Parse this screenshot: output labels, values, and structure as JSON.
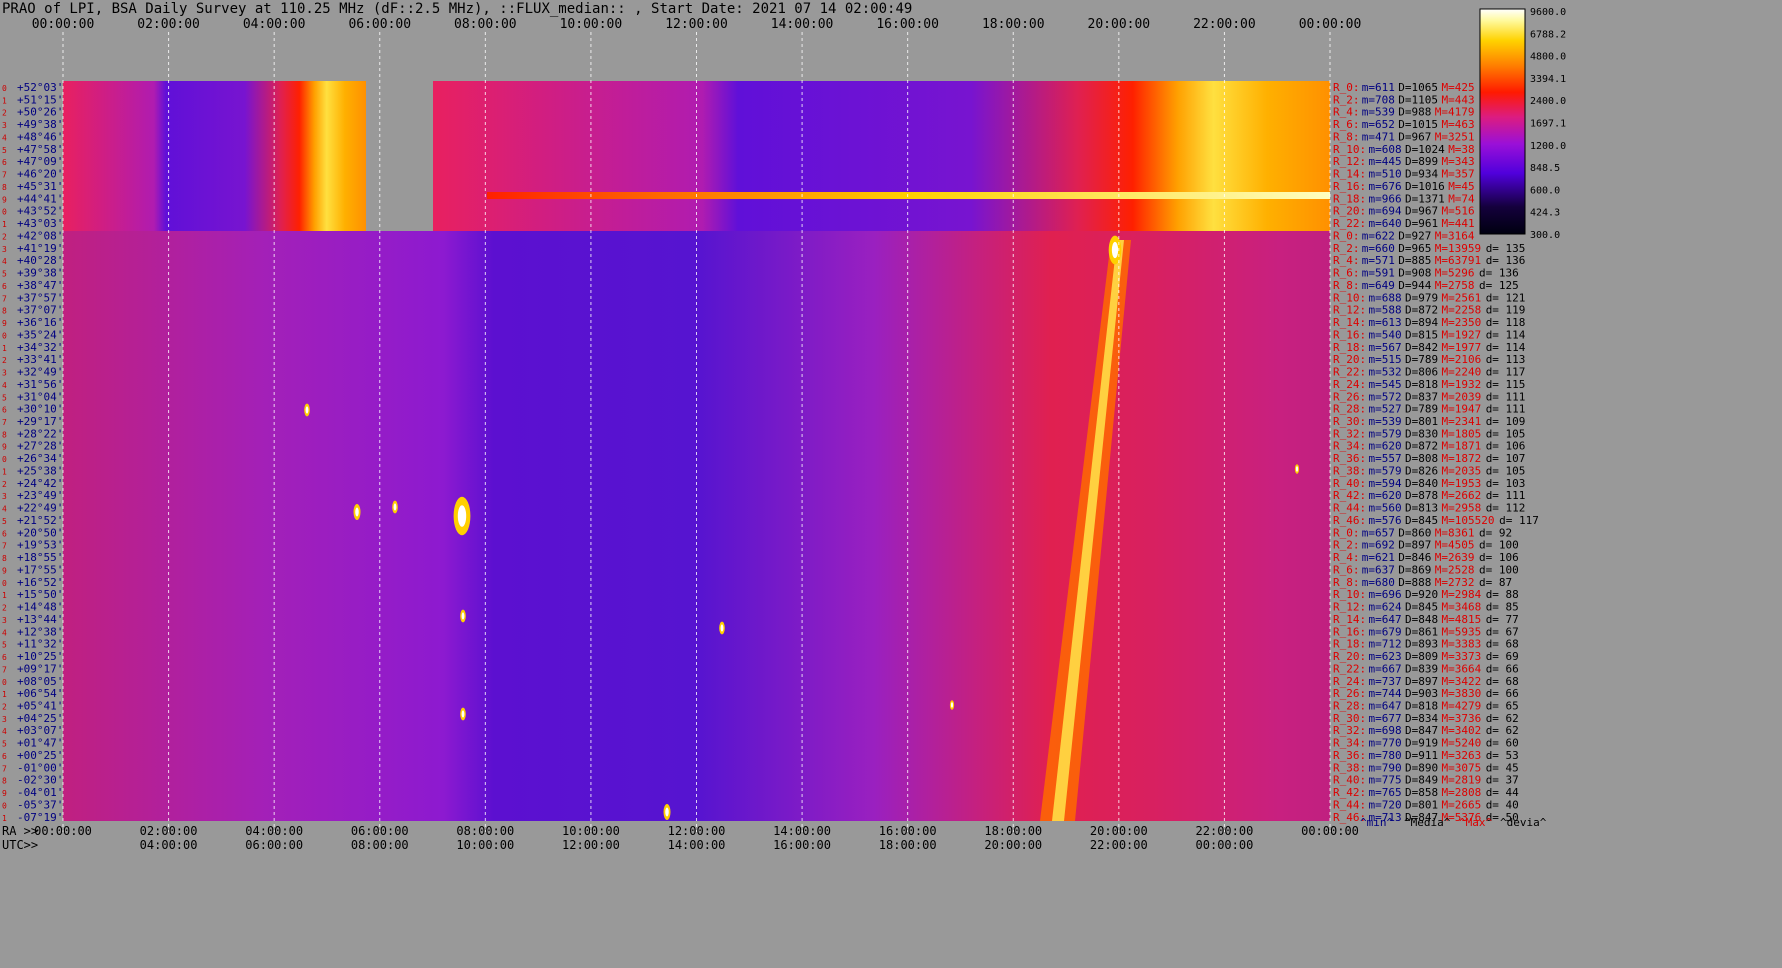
{
  "title": "PRAO of LPI, BSA Daily Survey at 110.25 MHz (dF::2.5 MHz), ::FLUX_median:: , Start Date: 2021 07 14 02:00:49",
  "colors": {
    "background": "#999999",
    "dec_labels_dark": "#000080",
    "dec_labels_red": "#cc0000",
    "stats_min": "#000080",
    "stats_max": "#dd0000"
  },
  "chart_data": {
    "type": "heatmap",
    "title": "PRAO of LPI, BSA Daily Survey at 110.25 MHz (dF::2.5 MHz), ::FLUX_median:: , Start Date: 2021 07 14 02:00:49",
    "x_top_ticks": [
      "00:00:00",
      "02:00:00",
      "04:00:00",
      "06:00:00",
      "08:00:00",
      "10:00:00",
      "12:00:00",
      "14:00:00",
      "16:00:00",
      "18:00:00",
      "20:00:00",
      "22:00:00",
      "00:00:00"
    ],
    "x_bottom_ra_label": "RA >>",
    "x_bottom_ra_ticks": [
      "00:00:00",
      "02:00:00",
      "04:00:00",
      "06:00:00",
      "08:00:00",
      "10:00:00",
      "12:00:00",
      "14:00:00",
      "16:00:00",
      "18:00:00",
      "20:00:00",
      "22:00:00",
      "00:00:00"
    ],
    "x_bottom_utc_label": "UTC>>",
    "x_bottom_utc_ticks": [
      "04:00:00",
      "06:00:00",
      "08:00:00",
      "10:00:00",
      "12:00:00",
      "14:00:00",
      "16:00:00",
      "18:00:00",
      "20:00:00",
      "22:00:00",
      "00:00:00"
    ],
    "dec_labels": [
      "+52°03'",
      "+51°15'",
      "+50°26'",
      "+49°38'",
      "+48°46'",
      "+47°58'",
      "+47°09'",
      "+46°20'",
      "+45°31'",
      "+44°41'",
      "+43°52'",
      "+43°03'",
      "+42°08'",
      "+41°19'",
      "+40°28'",
      "+39°38'",
      "+38°47'",
      "+37°57'",
      "+37°07'",
      "+36°16'",
      "+35°24'",
      "+34°32'",
      "+33°41'",
      "+32°49'",
      "+31°56'",
      "+31°04'",
      "+30°10'",
      "+29°17'",
      "+28°22'",
      "+27°28'",
      "+26°34'",
      "+25°38'",
      "+24°42'",
      "+23°49'",
      "+22°49'",
      "+21°52'",
      "+20°50'",
      "+19°53'",
      "+18°55'",
      "+17°55'",
      "+16°52'",
      "+15°50'",
      "+14°48'",
      "+13°44'",
      "+12°38'",
      "+11°32'",
      "+10°25'",
      "+09°17'",
      "+08°05'",
      "+06°54'",
      "+05°41'",
      "+04°25'",
      "+03°07'",
      "+01°47'",
      "+00°25'",
      "-01°00'",
      "-02°30'",
      "-04°01'",
      "-05°37'",
      "-07°19'"
    ],
    "colorbar": {
      "ticks": [
        "9600.0",
        "6788.2",
        "4800.0",
        "3394.1",
        "2400.0",
        "1697.1",
        "1200.0",
        "848.5",
        "600.0",
        "424.3",
        "300.0"
      ],
      "scale": "log"
    },
    "stats": [
      {
        "r": "R_0:",
        "m": "m=611",
        "d": "D=1065",
        "mx": "M=425",
        "dv": ""
      },
      {
        "r": "R_2:",
        "m": "m=708",
        "d": "D=1105",
        "mx": "M=443",
        "dv": ""
      },
      {
        "r": "R_4:",
        "m": "m=539",
        "d": "D=988",
        "mx": "M=4179",
        "dv": ""
      },
      {
        "r": "R_6:",
        "m": "m=652",
        "d": "D=1015",
        "mx": "M=463",
        "dv": ""
      },
      {
        "r": "R_8:",
        "m": "m=471",
        "d": "D=967",
        "mx": "M=3251",
        "dv": ""
      },
      {
        "r": "R_10:",
        "m": "m=608",
        "d": "D=1024",
        "mx": "M=38",
        "dv": ""
      },
      {
        "r": "R_12:",
        "m": "m=445",
        "d": "D=899",
        "mx": "M=343",
        "dv": ""
      },
      {
        "r": "R_14:",
        "m": "m=510",
        "d": "D=934",
        "mx": "M=357",
        "dv": ""
      },
      {
        "r": "R_16:",
        "m": "m=676",
        "d": "D=1016",
        "mx": "M=45",
        "dv": ""
      },
      {
        "r": "R_18:",
        "m": "m=966",
        "d": "D=1371",
        "mx": "M=74",
        "dv": ""
      },
      {
        "r": "R_20:",
        "m": "m=694",
        "d": "D=967",
        "mx": "M=516",
        "dv": ""
      },
      {
        "r": "R_22:",
        "m": "m=640",
        "d": "D=961",
        "mx": "M=441",
        "dv": ""
      },
      {
        "r": "R_0:",
        "m": "m=622",
        "d": "D=927",
        "mx": "M=3164",
        "dv": ""
      },
      {
        "r": "R_2:",
        "m": "m=660",
        "d": "D=965",
        "mx": "M=13959",
        "dv": "d= 135"
      },
      {
        "r": "R_4:",
        "m": "m=571",
        "d": "D=885",
        "mx": "M=63791",
        "dv": "d= 136"
      },
      {
        "r": "R_6:",
        "m": "m=591",
        "d": "D=908",
        "mx": "M=5296",
        "dv": "d= 136"
      },
      {
        "r": "R_8:",
        "m": "m=649",
        "d": "D=944",
        "mx": "M=2758",
        "dv": "d= 125"
      },
      {
        "r": "R_10:",
        "m": "m=688",
        "d": "D=979",
        "mx": "M=2561",
        "dv": "d= 121"
      },
      {
        "r": "R_12:",
        "m": "m=588",
        "d": "D=872",
        "mx": "M=2258",
        "dv": "d= 119"
      },
      {
        "r": "R_14:",
        "m": "m=613",
        "d": "D=894",
        "mx": "M=2350",
        "dv": "d= 118"
      },
      {
        "r": "R_16:",
        "m": "m=540",
        "d": "D=815",
        "mx": "M=1927",
        "dv": "d= 114"
      },
      {
        "r": "R_18:",
        "m": "m=567",
        "d": "D=842",
        "mx": "M=1977",
        "dv": "d= 114"
      },
      {
        "r": "R_20:",
        "m": "m=515",
        "d": "D=789",
        "mx": "M=2106",
        "dv": "d= 113"
      },
      {
        "r": "R_22:",
        "m": "m=532",
        "d": "D=806",
        "mx": "M=2240",
        "dv": "d= 117"
      },
      {
        "r": "R_24:",
        "m": "m=545",
        "d": "D=818",
        "mx": "M=1932",
        "dv": "d= 115"
      },
      {
        "r": "R_26:",
        "m": "m=572",
        "d": "D=837",
        "mx": "M=2039",
        "dv": "d= 111"
      },
      {
        "r": "R_28:",
        "m": "m=527",
        "d": "D=789",
        "mx": "M=1947",
        "dv": "d= 111"
      },
      {
        "r": "R_30:",
        "m": "m=539",
        "d": "D=801",
        "mx": "M=2341",
        "dv": "d= 109"
      },
      {
        "r": "R_32:",
        "m": "m=579",
        "d": "D=830",
        "mx": "M=1805",
        "dv": "d= 105"
      },
      {
        "r": "R_34:",
        "m": "m=620",
        "d": "D=872",
        "mx": "M=1871",
        "dv": "d= 106"
      },
      {
        "r": "R_36:",
        "m": "m=557",
        "d": "D=808",
        "mx": "M=1872",
        "dv": "d= 107"
      },
      {
        "r": "R_38:",
        "m": "m=579",
        "d": "D=826",
        "mx": "M=2035",
        "dv": "d= 105"
      },
      {
        "r": "R_40:",
        "m": "m=594",
        "d": "D=840",
        "mx": "M=1953",
        "dv": "d= 103"
      },
      {
        "r": "R_42:",
        "m": "m=620",
        "d": "D=878",
        "mx": "M=2662",
        "dv": "d= 111"
      },
      {
        "r": "R_44:",
        "m": "m=560",
        "d": "D=813",
        "mx": "M=2958",
        "dv": "d= 112"
      },
      {
        "r": "R_46:",
        "m": "m=576",
        "d": "D=845",
        "mx": "M=105520",
        "dv": "d= 117"
      },
      {
        "r": "R_0:",
        "m": "m=657",
        "d": "D=860",
        "mx": "M=8361",
        "dv": "d= 92"
      },
      {
        "r": "R_2:",
        "m": "m=692",
        "d": "D=897",
        "mx": "M=4505",
        "dv": "d= 100"
      },
      {
        "r": "R_4:",
        "m": "m=621",
        "d": "D=846",
        "mx": "M=2639",
        "dv": "d= 106"
      },
      {
        "r": "R_6:",
        "m": "m=637",
        "d": "D=869",
        "mx": "M=2528",
        "dv": "d= 100"
      },
      {
        "r": "R_8:",
        "m": "m=680",
        "d": "D=888",
        "mx": "M=2732",
        "dv": "d= 87"
      },
      {
        "r": "R_10:",
        "m": "m=696",
        "d": "D=920",
        "mx": "M=2984",
        "dv": "d= 88"
      },
      {
        "r": "R_12:",
        "m": "m=624",
        "d": "D=845",
        "mx": "M=3468",
        "dv": "d= 85"
      },
      {
        "r": "R_14:",
        "m": "m=647",
        "d": "D=848",
        "mx": "M=4815",
        "dv": "d= 77"
      },
      {
        "r": "R_16:",
        "m": "m=679",
        "d": "D=861",
        "mx": "M=5935",
        "dv": "d= 67"
      },
      {
        "r": "R_18:",
        "m": "m=712",
        "d": "D=893",
        "mx": "M=3383",
        "dv": "d= 68"
      },
      {
        "r": "R_20:",
        "m": "m=623",
        "d": "D=809",
        "mx": "M=3373",
        "dv": "d= 69"
      },
      {
        "r": "R_22:",
        "m": "m=667",
        "d": "D=839",
        "mx": "M=3664",
        "dv": "d= 66"
      },
      {
        "r": "R_24:",
        "m": "m=737",
        "d": "D=897",
        "mx": "M=3422",
        "dv": "d= 68"
      },
      {
        "r": "R_26:",
        "m": "m=744",
        "d": "D=903",
        "mx": "M=3830",
        "dv": "d= 66"
      },
      {
        "r": "R_28:",
        "m": "m=647",
        "d": "D=818",
        "mx": "M=4279",
        "dv": "d= 65"
      },
      {
        "r": "R_30:",
        "m": "m=677",
        "d": "D=834",
        "mx": "M=3736",
        "dv": "d= 62"
      },
      {
        "r": "R_32:",
        "m": "m=698",
        "d": "D=847",
        "mx": "M=3402",
        "dv": "d= 62"
      },
      {
        "r": "R_34:",
        "m": "m=770",
        "d": "D=919",
        "mx": "M=5240",
        "dv": "d= 60"
      },
      {
        "r": "R_36:",
        "m": "m=780",
        "d": "D=911",
        "mx": "M=3263",
        "dv": "d= 53"
      },
      {
        "r": "R_38:",
        "m": "m=790",
        "d": "D=890",
        "mx": "M=3075",
        "dv": "d= 45"
      },
      {
        "r": "R_40:",
        "m": "m=775",
        "d": "D=849",
        "mx": "M=2819",
        "dv": "d= 37"
      },
      {
        "r": "R_42:",
        "m": "m=765",
        "d": "D=858",
        "mx": "M=2808",
        "dv": "d= 44"
      },
      {
        "r": "R_44:",
        "m": "m=720",
        "d": "D=801",
        "mx": "M=2665",
        "dv": "d= 40"
      },
      {
        "r": "R_46:",
        "m": "m=713",
        "d": "D=847",
        "mx": "M=5376",
        "dv": "d= 50"
      }
    ],
    "legend_footer": [
      "^min^",
      "^Media^",
      "^Max^",
      "^devia^"
    ]
  }
}
